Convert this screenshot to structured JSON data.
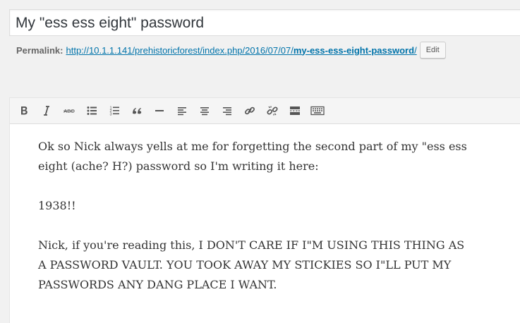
{
  "post": {
    "title": "My \"ess ess eight\" password"
  },
  "permalink": {
    "label": "Permalink:",
    "url_base": "http://10.1.1.141/prehistoricforest/index.php/2016/07/07/",
    "slug": "my-ess-ess-eight-password",
    "trailing": "/",
    "edit_label": "Edit"
  },
  "toolbar": {
    "buttons": [
      {
        "name": "bold-icon",
        "icon": "bold"
      },
      {
        "name": "italic-icon",
        "icon": "italic"
      },
      {
        "name": "strikethrough-icon",
        "icon": "strikethrough"
      },
      {
        "name": "bulleted-list-icon",
        "icon": "bulleted-list"
      },
      {
        "name": "numbered-list-icon",
        "icon": "numbered-list"
      },
      {
        "name": "blockquote-icon",
        "icon": "blockquote"
      },
      {
        "name": "horizontal-line-icon",
        "icon": "horizontal-line"
      },
      {
        "name": "align-left-icon",
        "icon": "align-left"
      },
      {
        "name": "align-center-icon",
        "icon": "align-center"
      },
      {
        "name": "align-right-icon",
        "icon": "align-right"
      },
      {
        "name": "insert-link-icon",
        "icon": "link"
      },
      {
        "name": "remove-link-icon",
        "icon": "unlink"
      },
      {
        "name": "insert-read-more-icon",
        "icon": "read-more"
      },
      {
        "name": "toolbar-toggle-icon",
        "icon": "keyboard"
      }
    ]
  },
  "body": {
    "paragraphs": [
      "Ok so Nick always yells at me for forgetting the second part of my \"ess ess eight (ache? H?) password so I'm writing it here:",
      "1938!!",
      "Nick, if you're reading this, I DON'T CARE IF I\"M USING THIS THING AS A PASSWORD VAULT. YOU TOOK AWAY MY STICKIES SO I\"LL PUT MY PASSWORDS ANY DANG PLACE I WANT."
    ]
  },
  "colors": {
    "link": "#0073aa",
    "icon": "#555555",
    "toolbar_bg": "#f5f5f5",
    "page_bg": "#f1f1f1"
  }
}
